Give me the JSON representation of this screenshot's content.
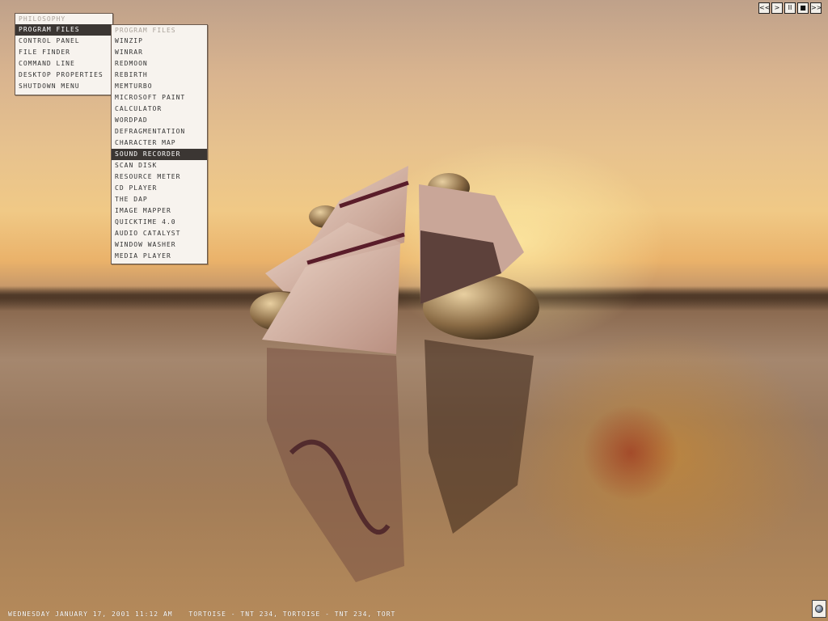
{
  "main_menu": {
    "title": "Philosophy",
    "items": [
      {
        "label": "Program Files",
        "active": true
      },
      {
        "label": "Control Panel"
      },
      {
        "label": "File Finder"
      },
      {
        "label": "Command Line"
      },
      {
        "label": "Desktop Properties"
      },
      {
        "label": "Shutdown Menu"
      }
    ]
  },
  "programs_menu": {
    "title": "Program Files",
    "items": [
      {
        "label": "WinZip"
      },
      {
        "label": "WinRAR"
      },
      {
        "label": "RedMoon"
      },
      {
        "label": "Rebirth"
      },
      {
        "label": "MemTurbo"
      },
      {
        "label": "Microsoft Paint"
      },
      {
        "label": "Calculator"
      },
      {
        "label": "WordPad"
      },
      {
        "label": "Defragmentation"
      },
      {
        "label": "Character Map"
      },
      {
        "label": "Sound Recorder",
        "active": true
      },
      {
        "label": "Scan Disk"
      },
      {
        "label": "Resource Meter"
      },
      {
        "label": "CD Player"
      },
      {
        "label": "The Dap"
      },
      {
        "label": "Image Mapper"
      },
      {
        "label": "QuickTime 4.0"
      },
      {
        "label": "Audio Catalyst"
      },
      {
        "label": "Window Washer"
      },
      {
        "label": "Media Player"
      }
    ]
  },
  "media_controls": [
    {
      "name": "previous-button",
      "icon": "prev-icon",
      "glyph": "<<"
    },
    {
      "name": "play-button",
      "icon": "play-icon",
      "glyph": ">"
    },
    {
      "name": "pause-button",
      "icon": "pause-icon",
      "glyph": "II"
    },
    {
      "name": "stop-button",
      "icon": "stop-icon",
      "glyph": "■"
    },
    {
      "name": "next-button",
      "icon": "next-icon",
      "glyph": ">>"
    }
  ],
  "status_bar": {
    "datetime": "Wednesday January 17, 2001 11:12 AM",
    "ticker": "Tortoise - TNT 234, Tortoise - TNT 234, Tort"
  },
  "tray": {
    "icon": "globe-icon"
  },
  "colors": {
    "menu_bg": "#f7f3ee",
    "menu_active_bg": "#3b3633",
    "menu_title": "#aaa29a"
  }
}
